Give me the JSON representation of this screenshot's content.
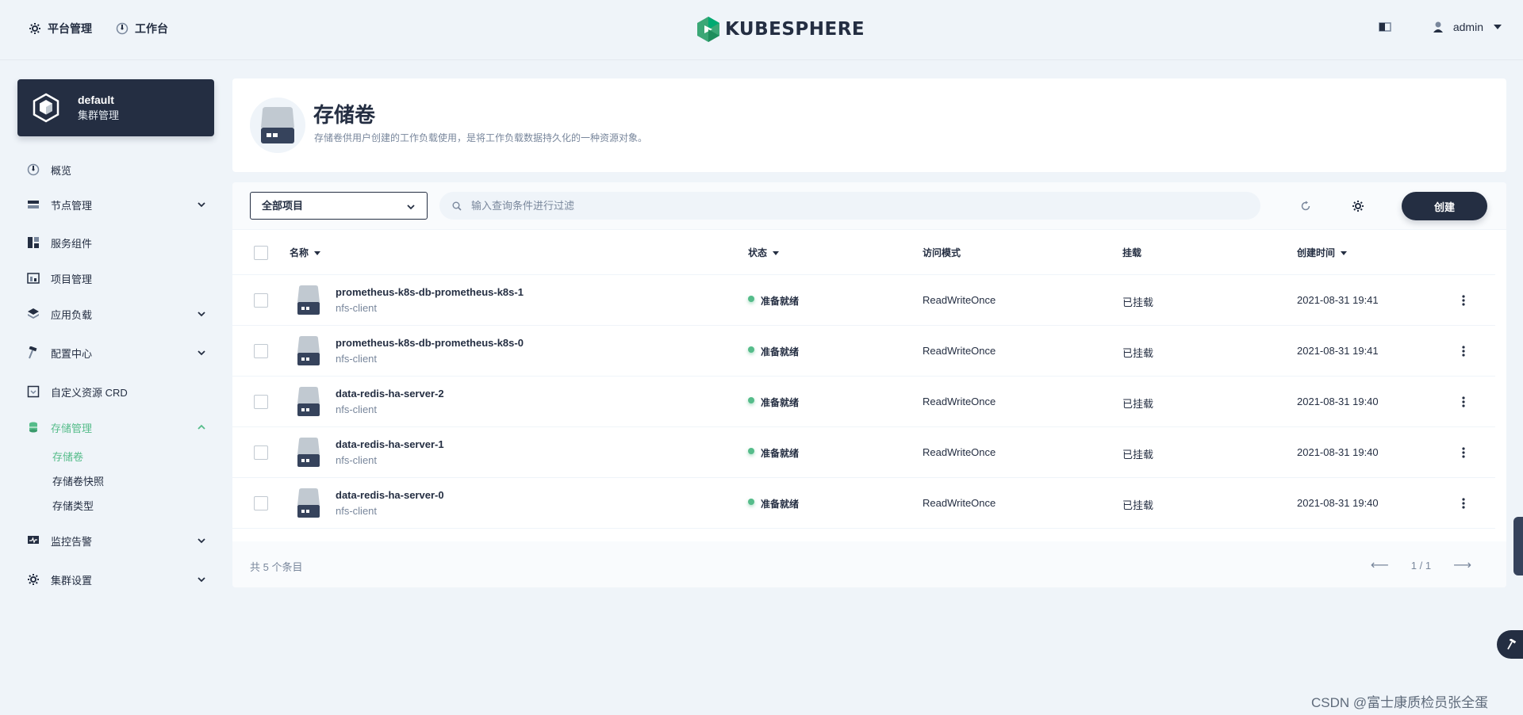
{
  "topbar": {
    "platform_label": "平台管理",
    "workbench_label": "工作台",
    "brand": "KUBESPHERE",
    "user": "admin"
  },
  "cluster": {
    "name": "default",
    "desc": "集群管理"
  },
  "sidebar": {
    "items": [
      {
        "label": "概览",
        "icon": "dashboard-icon"
      },
      {
        "label": "节点管理",
        "icon": "nodes-icon"
      },
      {
        "label": "服务组件",
        "icon": "components-icon"
      },
      {
        "label": "项目管理",
        "icon": "project-icon"
      },
      {
        "label": "应用负载",
        "icon": "workload-icon"
      },
      {
        "label": "配置中心",
        "icon": "hammer-icon"
      },
      {
        "label": "自定义资源 CRD",
        "icon": "crd-icon"
      },
      {
        "label": "存储管理",
        "icon": "storage-icon"
      },
      {
        "label": "监控告警",
        "icon": "monitor-icon"
      },
      {
        "label": "集群设置",
        "icon": "gear-icon"
      }
    ],
    "storage_sub": [
      "存储卷",
      "存储卷快照",
      "存储类型"
    ]
  },
  "header": {
    "title": "存储卷",
    "desc": "存储卷供用户创建的工作负载使用，是将工作负载数据持久化的一种资源对象。"
  },
  "toolbar": {
    "project_select": "全部项目",
    "search_placeholder": "输入查询条件进行过滤",
    "create_label": "创建"
  },
  "table": {
    "headers": [
      "名称",
      "状态",
      "访问模式",
      "挂载",
      "创建时间"
    ],
    "rows": [
      {
        "name": "prometheus-k8s-db-prometheus-k8s-1",
        "sub": "nfs-client",
        "status": "准备就绪",
        "mode": "ReadWriteOnce",
        "mount": "已挂载",
        "created": "2021-08-31 19:41"
      },
      {
        "name": "prometheus-k8s-db-prometheus-k8s-0",
        "sub": "nfs-client",
        "status": "准备就绪",
        "mode": "ReadWriteOnce",
        "mount": "已挂载",
        "created": "2021-08-31 19:41"
      },
      {
        "name": "data-redis-ha-server-2",
        "sub": "nfs-client",
        "status": "准备就绪",
        "mode": "ReadWriteOnce",
        "mount": "已挂载",
        "created": "2021-08-31 19:40"
      },
      {
        "name": "data-redis-ha-server-1",
        "sub": "nfs-client",
        "status": "准备就绪",
        "mode": "ReadWriteOnce",
        "mount": "已挂载",
        "created": "2021-08-31 19:40"
      },
      {
        "name": "data-redis-ha-server-0",
        "sub": "nfs-client",
        "status": "准备就绪",
        "mode": "ReadWriteOnce",
        "mount": "已挂载",
        "created": "2021-08-31 19:40"
      }
    ],
    "total": "共 5 个条目",
    "page": "1 / 1"
  },
  "watermark": "CSDN @富士康质检员张全蛋",
  "colors": {
    "accent": "#55bc8a",
    "dark": "#242e42",
    "muted": "#79879c"
  }
}
